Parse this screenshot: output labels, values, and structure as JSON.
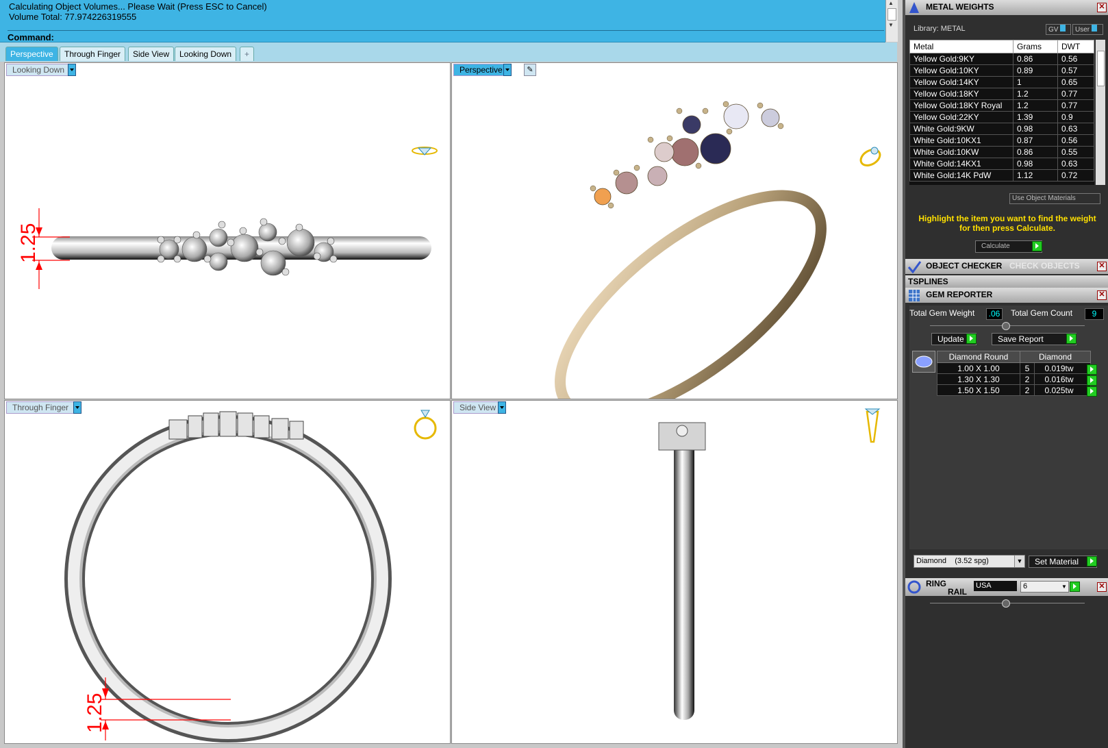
{
  "command": {
    "line1": "Calculating Object Volumes... Please Wait (Press ESC to Cancel)",
    "line2": "Volume Total: 77.974226319555",
    "prompt": "Command:"
  },
  "tabs": [
    "Perspective",
    "Through Finger",
    "Side View",
    "Looking Down"
  ],
  "tab_add": "+",
  "viewports": {
    "top_left": {
      "label": "Looking Down",
      "dimension": "1.25"
    },
    "top_right": {
      "label": "Perspective"
    },
    "bottom_left": {
      "label": "Through Finger",
      "dimension": "1.25"
    },
    "bottom_right": {
      "label": "Side View"
    }
  },
  "metal_weights": {
    "title": "METAL WEIGHTS",
    "library_label": "Library: METAL",
    "gv_label": "GV",
    "user_label": "User",
    "columns": [
      "Metal",
      "Grams",
      "DWT"
    ],
    "rows": [
      [
        "Yellow Gold:9KY",
        "0.86",
        "0.56"
      ],
      [
        "Yellow Gold:10KY",
        "0.89",
        "0.57"
      ],
      [
        "Yellow Gold:14KY",
        "1",
        "0.65"
      ],
      [
        "Yellow Gold:18KY",
        "1.2",
        "0.77"
      ],
      [
        "Yellow Gold:18KY Royal",
        "1.2",
        "0.77"
      ],
      [
        "Yellow Gold:22KY",
        "1.39",
        "0.9"
      ],
      [
        "White Gold:9KW",
        "0.98",
        "0.63"
      ],
      [
        "White Gold:10KX1",
        "0.87",
        "0.56"
      ],
      [
        "White Gold:10KW",
        "0.86",
        "0.55"
      ],
      [
        "White Gold:14KX1",
        "0.98",
        "0.63"
      ],
      [
        "White Gold:14K PdW",
        "1.12",
        "0.72"
      ]
    ],
    "use_object_materials": "Use Object Materials",
    "hint": "Highlight the item you want to find the weight for then press Calculate.",
    "calculate_label": "Calculate"
  },
  "object_checker": {
    "title": "OBJECT CHECKER",
    "check_label": "CHECK OBJECTS"
  },
  "tsplines": {
    "title": "TSPLINES"
  },
  "gem_reporter": {
    "title": "GEM REPORTER",
    "total_weight_label": "Total Gem Weight",
    "total_weight_value": ".06",
    "total_count_label": "Total Gem Count",
    "total_count_value": "9",
    "update_label": "Update",
    "save_report_label": "Save Report",
    "table_headers": [
      "Diamond Round",
      "Diamond"
    ],
    "rows": [
      [
        "1.00 X 1.00",
        "5",
        "0.019tw"
      ],
      [
        "1.30 X 1.30",
        "2",
        "0.016tw"
      ],
      [
        "1.50 X 1.50",
        "2",
        "0.025tw"
      ]
    ],
    "material_select": "Diamond    (3.52 spg)",
    "set_material_label": "Set Material"
  },
  "ring_rail": {
    "title_line1": "RING",
    "title_line2": "RAIL",
    "country": "USA",
    "size": "6"
  },
  "colors": {
    "accent": "#3eb4e4",
    "panel_bg": "#2f2f2f",
    "gold": "#b9a27a",
    "dimension": "#ff0000",
    "hint_text": "#ffe000"
  }
}
